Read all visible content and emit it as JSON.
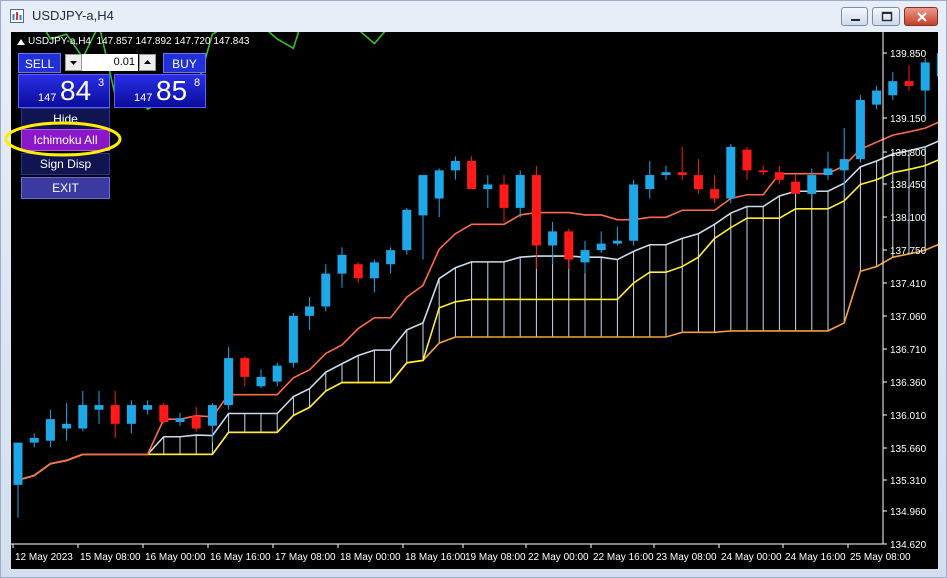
{
  "window": {
    "title": "USDJPY-a,H4"
  },
  "chart_header": "USDJPY-a,H4  147.857 147.892 147.720 147.843",
  "trade_panel": {
    "sell_label": "SELL",
    "buy_label": "BUY",
    "lot_value": "0.01",
    "sell_price": {
      "prefix": "147",
      "big": "84",
      "super": "3"
    },
    "buy_price": {
      "prefix": "147",
      "big": "85",
      "super": "8"
    }
  },
  "side_menu": [
    {
      "label": "Hide"
    },
    {
      "label": "Ichimoku All"
    },
    {
      "label": "Sign Disp"
    },
    {
      "label": "EXIT"
    }
  ],
  "colors": {
    "background": "#000000",
    "bull_candle": "#1ea8e8",
    "bear_candle": "#ff1a1a",
    "tenkan": "#ff6b4a",
    "kijun": "#ffee33",
    "chikou": "#3bbf2a",
    "kumo_bear": "#f2a23a",
    "kumo_bull": "#c8dcee",
    "highlight": "#ffee00",
    "menu_active": "#8a18c8"
  },
  "chart_data": {
    "type": "candlestick",
    "y_ticks": [
      "139.850",
      "139.150",
      "138.800",
      "138.450",
      "138.100",
      "137.750",
      "137.410",
      "137.060",
      "136.710",
      "136.360",
      "136.010",
      "135.660",
      "135.310",
      "134.960",
      "134.620"
    ],
    "x_ticks": [
      "12 May 2023",
      "15 May 08:00",
      "16 May 00:00",
      "16 May 16:00",
      "17 May 08:00",
      "18 May 00:00",
      "18 May 16:00",
      "19 May 08:00",
      "22 May 00:00",
      "22 May 16:00",
      "23 May 08:00",
      "24 May 00:00",
      "24 May 16:00",
      "25 May 08:00"
    ],
    "ylim": [
      134.55,
      140.05
    ],
    "candles": [
      {
        "o": 135.25,
        "h": 135.7,
        "l": 134.9,
        "c": 135.7
      },
      {
        "o": 135.7,
        "h": 135.8,
        "l": 135.65,
        "c": 135.75
      },
      {
        "o": 135.72,
        "h": 136.05,
        "l": 135.65,
        "c": 135.95
      },
      {
        "o": 135.85,
        "h": 136.12,
        "l": 135.72,
        "c": 135.9
      },
      {
        "o": 135.85,
        "h": 136.25,
        "l": 135.82,
        "c": 136.1
      },
      {
        "o": 136.05,
        "h": 136.25,
        "l": 135.9,
        "c": 136.1
      },
      {
        "o": 136.1,
        "h": 136.25,
        "l": 135.75,
        "c": 135.9
      },
      {
        "o": 135.9,
        "h": 136.15,
        "l": 135.8,
        "c": 136.1
      },
      {
        "o": 136.05,
        "h": 136.15,
        "l": 136.0,
        "c": 136.1
      },
      {
        "o": 136.1,
        "h": 136.12,
        "l": 135.9,
        "c": 135.92
      },
      {
        "o": 135.92,
        "h": 136.02,
        "l": 135.88,
        "c": 135.96
      },
      {
        "o": 135.98,
        "h": 136.08,
        "l": 135.82,
        "c": 135.85
      },
      {
        "o": 135.88,
        "h": 136.12,
        "l": 135.7,
        "c": 136.1
      },
      {
        "o": 136.1,
        "h": 136.72,
        "l": 136.05,
        "c": 136.6
      },
      {
        "o": 136.6,
        "h": 136.62,
        "l": 136.3,
        "c": 136.4
      },
      {
        "o": 136.3,
        "h": 136.48,
        "l": 136.28,
        "c": 136.4
      },
      {
        "o": 136.35,
        "h": 136.55,
        "l": 136.3,
        "c": 136.52
      },
      {
        "o": 136.55,
        "h": 137.08,
        "l": 136.5,
        "c": 137.05
      },
      {
        "o": 137.05,
        "h": 137.25,
        "l": 136.9,
        "c": 137.15
      },
      {
        "o": 137.15,
        "h": 137.6,
        "l": 137.1,
        "c": 137.5
      },
      {
        "o": 137.5,
        "h": 137.78,
        "l": 137.35,
        "c": 137.7
      },
      {
        "o": 137.6,
        "h": 137.62,
        "l": 137.4,
        "c": 137.45
      },
      {
        "o": 137.45,
        "h": 137.65,
        "l": 137.3,
        "c": 137.62
      },
      {
        "o": 137.6,
        "h": 137.78,
        "l": 137.5,
        "c": 137.75
      },
      {
        "o": 137.75,
        "h": 138.2,
        "l": 137.7,
        "c": 138.18
      },
      {
        "o": 138.12,
        "h": 138.25,
        "l": 137.65,
        "c": 138.55
      },
      {
        "o": 138.3,
        "h": 138.62,
        "l": 138.1,
        "c": 138.6
      },
      {
        "o": 138.6,
        "h": 138.75,
        "l": 138.5,
        "c": 138.7
      },
      {
        "o": 138.7,
        "h": 138.75,
        "l": 138.45,
        "c": 138.4
      },
      {
        "o": 138.4,
        "h": 138.55,
        "l": 138.2,
        "c": 138.45
      },
      {
        "o": 138.45,
        "h": 138.55,
        "l": 138.05,
        "c": 138.2
      },
      {
        "o": 138.2,
        "h": 138.6,
        "l": 138.1,
        "c": 138.55
      },
      {
        "o": 138.55,
        "h": 138.65,
        "l": 137.55,
        "c": 137.8
      },
      {
        "o": 137.8,
        "h": 138.05,
        "l": 137.6,
        "c": 137.95
      },
      {
        "o": 137.95,
        "h": 137.98,
        "l": 137.55,
        "c": 137.65
      },
      {
        "o": 137.62,
        "h": 137.85,
        "l": 137.5,
        "c": 137.75
      },
      {
        "o": 137.75,
        "h": 137.95,
        "l": 137.72,
        "c": 137.82
      },
      {
        "o": 137.82,
        "h": 138.0,
        "l": 137.8,
        "c": 137.85
      },
      {
        "o": 137.85,
        "h": 138.5,
        "l": 137.8,
        "c": 138.45
      },
      {
        "o": 138.4,
        "h": 138.7,
        "l": 138.3,
        "c": 138.55
      },
      {
        "o": 138.55,
        "h": 138.65,
        "l": 138.5,
        "c": 138.58
      },
      {
        "o": 138.58,
        "h": 138.85,
        "l": 138.5,
        "c": 138.55
      },
      {
        "o": 138.55,
        "h": 138.72,
        "l": 138.35,
        "c": 138.4
      },
      {
        "o": 138.4,
        "h": 138.55,
        "l": 138.25,
        "c": 138.3
      },
      {
        "o": 138.3,
        "h": 138.88,
        "l": 138.25,
        "c": 138.85
      },
      {
        "o": 138.82,
        "h": 138.85,
        "l": 138.5,
        "c": 138.6
      },
      {
        "o": 138.6,
        "h": 138.65,
        "l": 138.55,
        "c": 138.58
      },
      {
        "o": 138.58,
        "h": 138.65,
        "l": 138.45,
        "c": 138.5
      },
      {
        "o": 138.48,
        "h": 138.55,
        "l": 138.35,
        "c": 138.35
      },
      {
        "o": 138.35,
        "h": 138.62,
        "l": 138.3,
        "c": 138.55
      },
      {
        "o": 138.55,
        "h": 138.8,
        "l": 138.5,
        "c": 138.62
      },
      {
        "o": 138.6,
        "h": 139.05,
        "l": 138.35,
        "c": 138.72
      },
      {
        "o": 138.72,
        "h": 139.4,
        "l": 138.68,
        "c": 139.35
      },
      {
        "o": 139.3,
        "h": 139.5,
        "l": 139.25,
        "c": 139.45
      },
      {
        "o": 139.4,
        "h": 139.65,
        "l": 139.35,
        "c": 139.55
      },
      {
        "o": 139.55,
        "h": 139.72,
        "l": 139.45,
        "c": 139.5
      },
      {
        "o": 139.45,
        "h": 139.8,
        "l": 139.15,
        "c": 139.75
      },
      {
        "o": 139.6,
        "h": 139.95,
        "l": 139.55,
        "c": 139.85
      }
    ]
  }
}
